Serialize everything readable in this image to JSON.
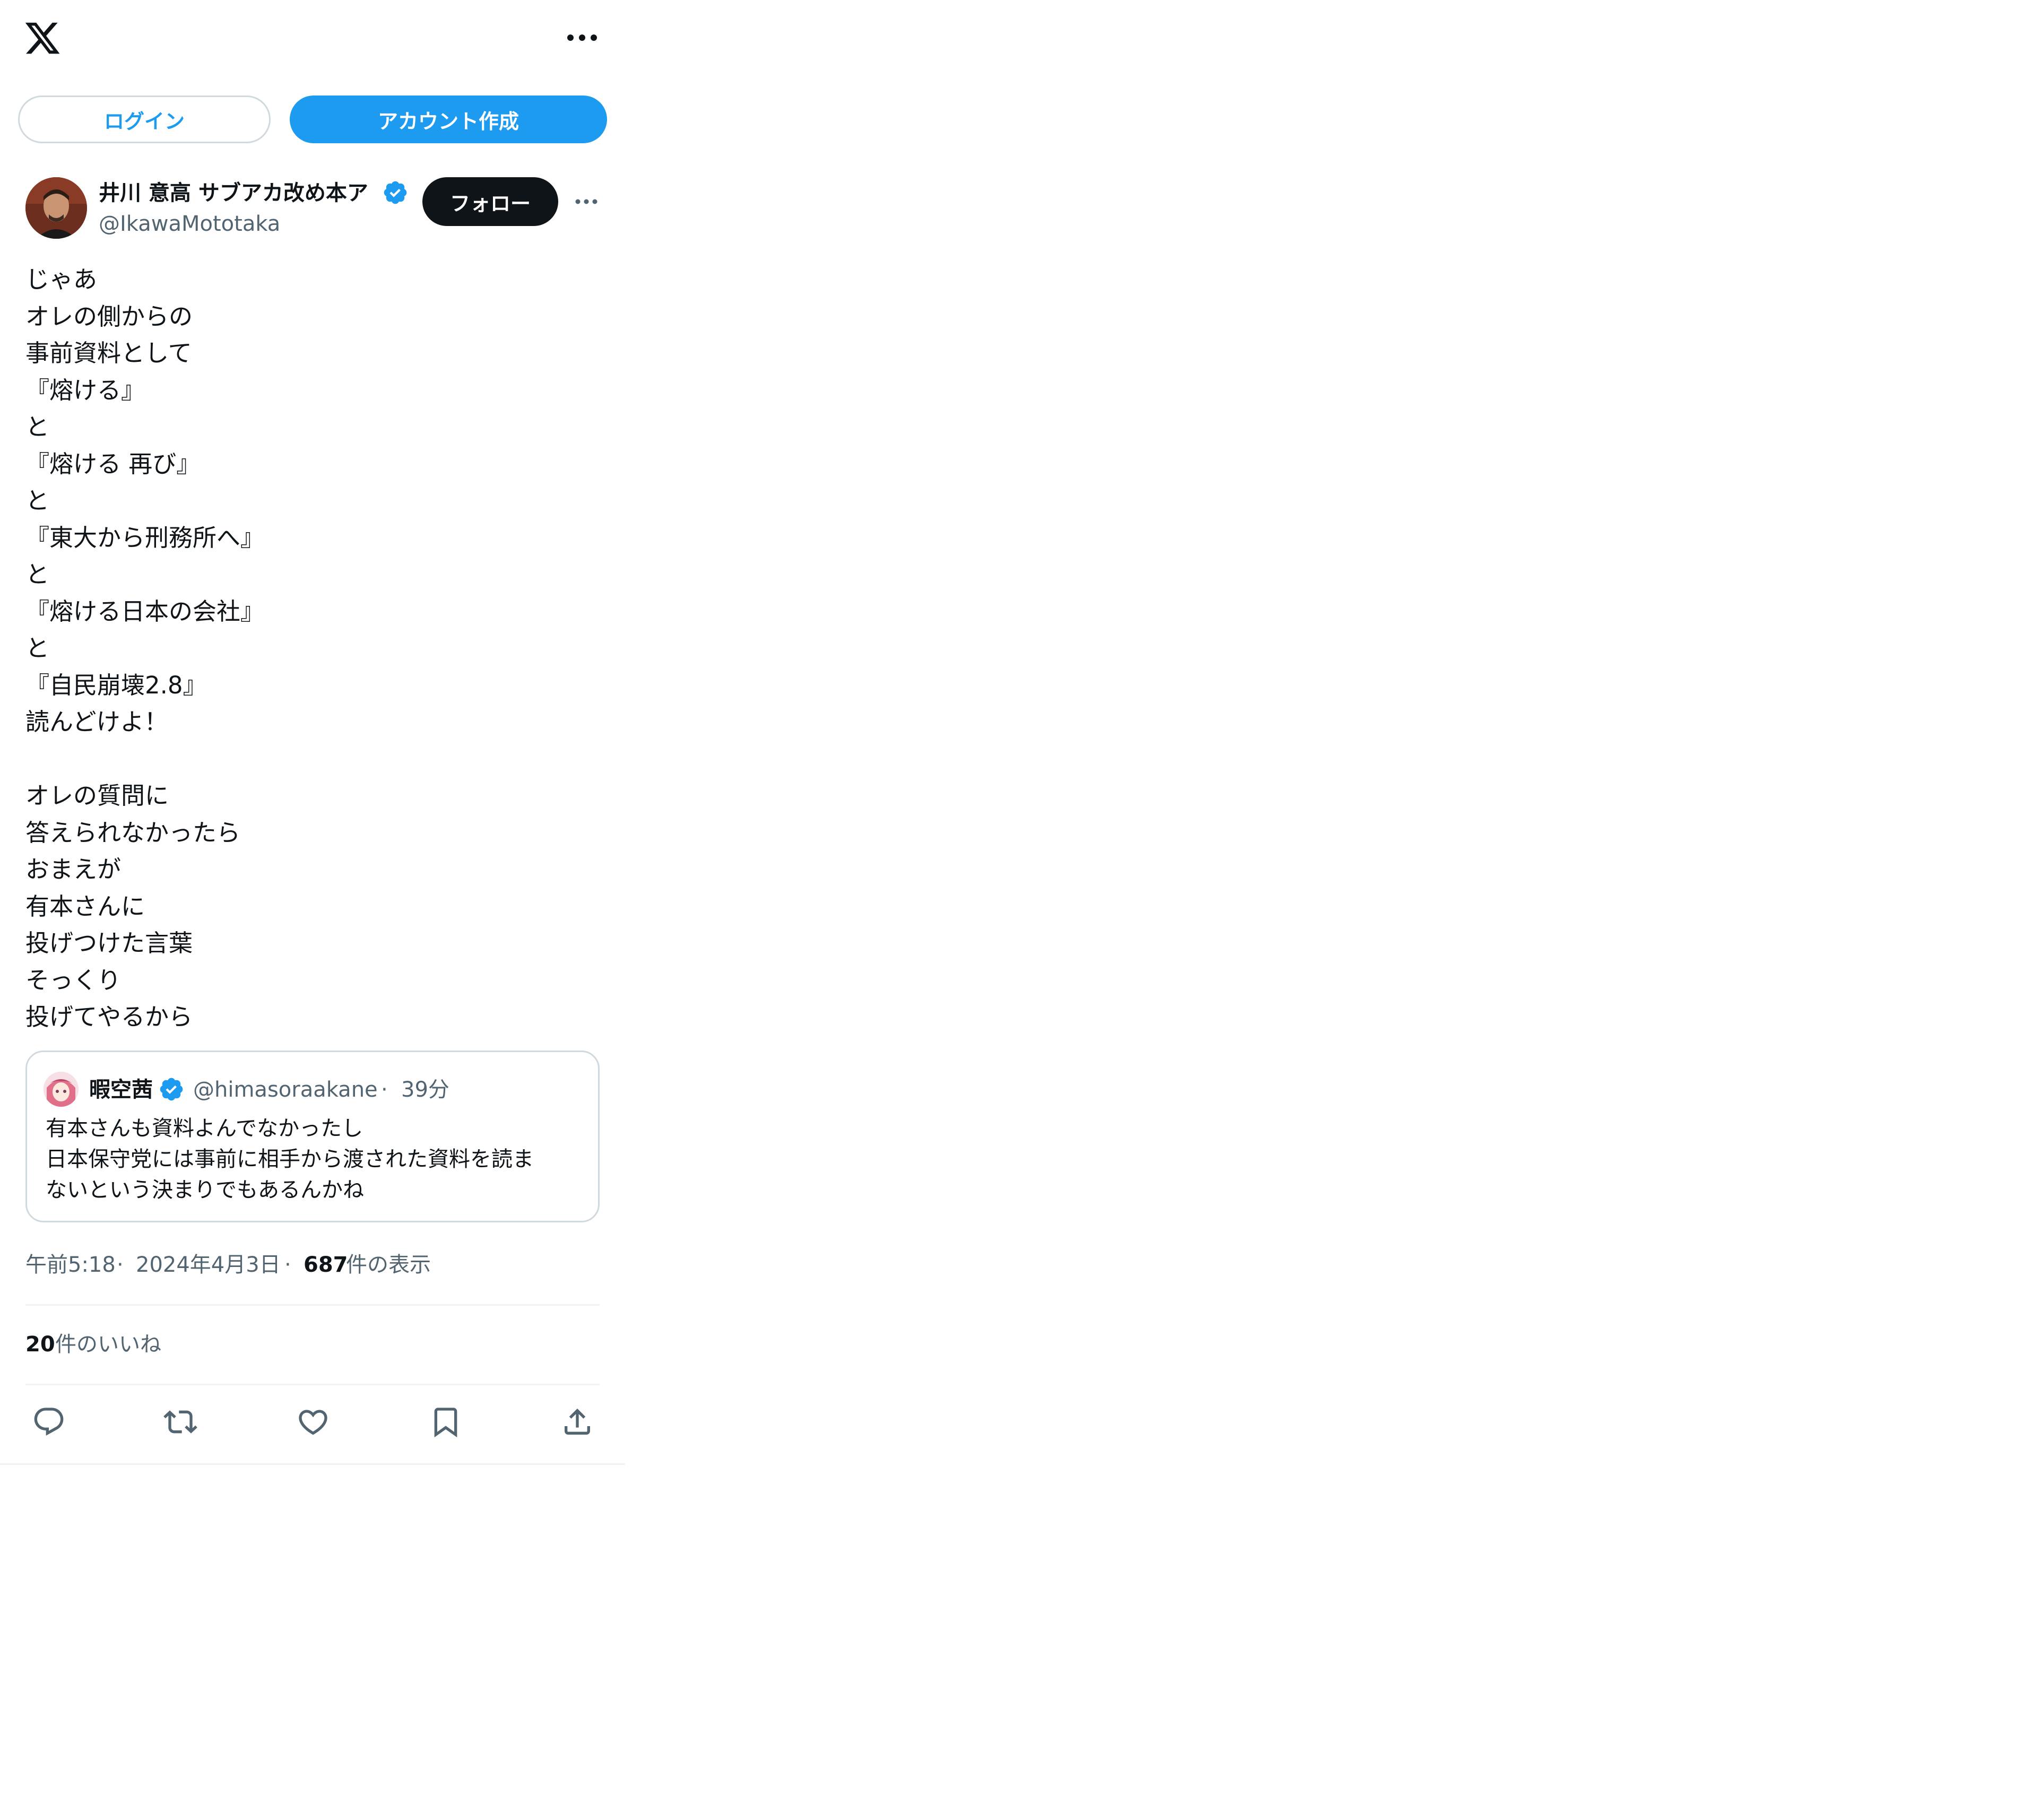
{
  "header": {
    "logo_icon": "x-logo-icon",
    "more_icon": "more-horizontal-icon"
  },
  "auth": {
    "login_label": "ログイン",
    "signup_label": "アカウント作成"
  },
  "post": {
    "author_name": "井川 意高 サブアカ改め本ア",
    "author_handle": "@IkawaMototaka",
    "verified_icon": "verified-badge-icon",
    "follow_label": "フォロー",
    "text_lines": [
      "じゃあ",
      "オレの側からの",
      "事前資料として",
      "『熔ける』",
      "と",
      "『熔ける 再び』",
      "と",
      "『東大から刑務所へ』",
      "と",
      "『熔ける日本の会社』",
      "と",
      "『自民崩壊2.8』",
      "読んどけよ！",
      "",
      "オレの質問に",
      "答えられなかったら",
      "おまえが",
      "有本さんに",
      "投げつけた言葉",
      "そっくり",
      "投げてやるから"
    ],
    "quote": {
      "name": "暇空茜",
      "handle": "@himasoraakane",
      "separator": "·",
      "time": "39分",
      "text_lines": [
        "有本さんも資料よんでなかったし",
        "日本保守党には事前に相手から渡された資料を読ま",
        "ないという決まりでもあるんかね"
      ]
    },
    "meta": {
      "time": "午前5:18",
      "separator": "·",
      "date": "2024年4月3日",
      "views_count": "687",
      "views_label": "件の表示"
    },
    "likes": {
      "count": "20",
      "label": "件のいいね"
    },
    "actions": [
      "reply-icon",
      "retweet-icon",
      "like-icon",
      "bookmark-icon",
      "share-icon"
    ]
  },
  "colors": {
    "accent": "#1d9bf0",
    "text": "#0f1419",
    "secondary": "#536471",
    "border": "#cfd9de",
    "divider": "#eff3f4"
  }
}
